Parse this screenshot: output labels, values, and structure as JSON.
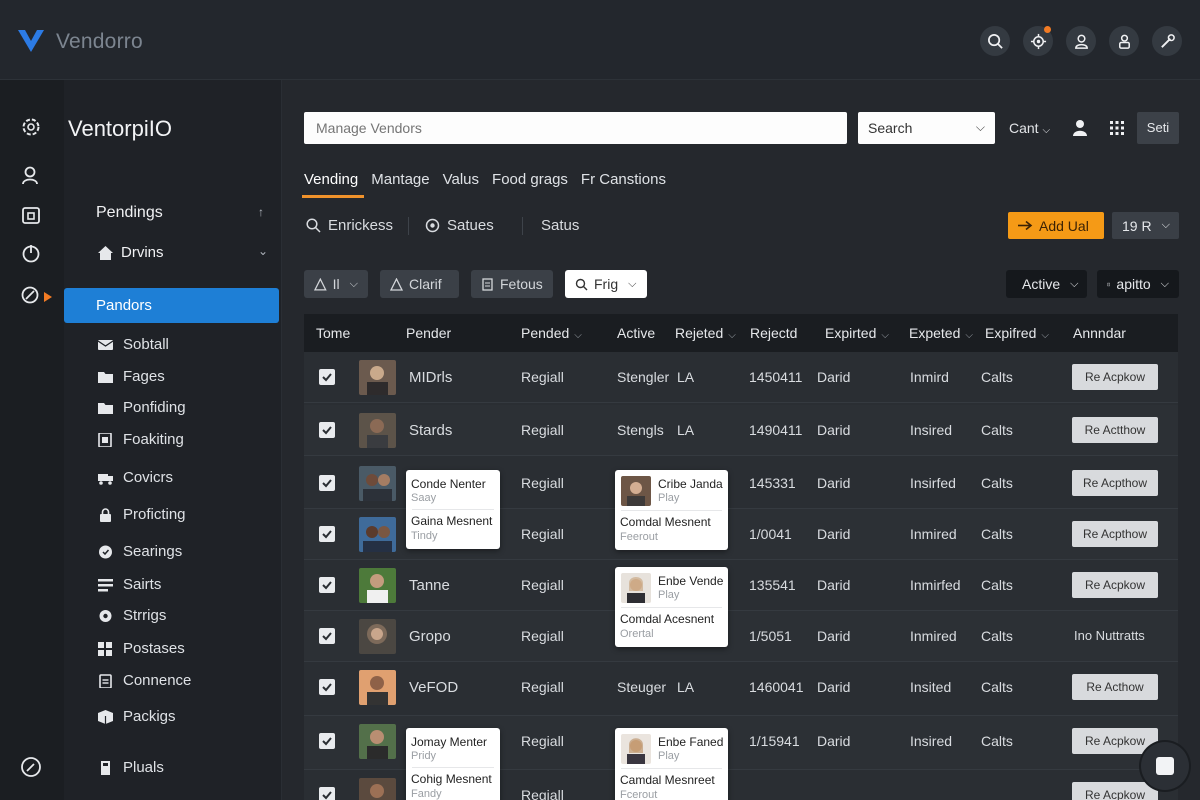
{
  "app": {
    "brand": "Vendorro"
  },
  "top_icons": [
    "search-icon",
    "notifications-icon",
    "user-icon",
    "account-icon",
    "tools-icon"
  ],
  "sidebar": {
    "title": "VentorpiIO",
    "section1": "Pendings",
    "section2": "Drvins",
    "active_item": "Pandors",
    "items": [
      {
        "label": "Sobtall",
        "icon": "mail-icon"
      },
      {
        "label": "Fages",
        "icon": "folder-icon"
      },
      {
        "label": "Ponfiding",
        "icon": "folder-icon"
      },
      {
        "label": "Foakiting",
        "icon": "document-icon"
      },
      {
        "label": "Covicrs",
        "icon": "truck-icon"
      },
      {
        "label": "Proficting",
        "icon": "lock-icon"
      },
      {
        "label": "Searings",
        "icon": "shield-icon"
      },
      {
        "label": "Sairts",
        "icon": "list-icon"
      },
      {
        "label": "Strrigs",
        "icon": "gear-icon"
      },
      {
        "label": "Postases",
        "icon": "grid-icon"
      },
      {
        "label": "Connence",
        "icon": "clipboard-icon"
      },
      {
        "label": "Packigs",
        "icon": "package-icon"
      },
      {
        "label": "Pluals",
        "icon": "bookmark-icon"
      }
    ]
  },
  "header": {
    "search_placeholder": "Manage Vendors",
    "search_select": "Search",
    "cant_label": "Cant",
    "seti_label": "Seti"
  },
  "tabs": [
    "Vending",
    "Mantage",
    "Valus",
    "Food grags",
    "Fr Canstions"
  ],
  "filters": {
    "item1": "Enrickess",
    "item2": "Satues",
    "item3": "Satus",
    "add_button": "Add Ual",
    "page_select": "19 R"
  },
  "toolbar": {
    "btn1": "Il",
    "btn2": "Clarif",
    "btn3": "Fetous",
    "btn4": "Frig",
    "btn5": "Active",
    "btn6": "apitto"
  },
  "table": {
    "headers": [
      "Tome",
      "Pender",
      "Pended",
      "Active",
      "Rejeted",
      "Rejectd",
      "Expirted",
      "Expeted",
      "Expifred",
      "Annndar"
    ],
    "rows": [
      {
        "name": "MIDrls",
        "pended": "Regiall",
        "active": "Stengler",
        "rej1": "LA",
        "rej2": "1450411",
        "exp1": "Darid",
        "exp2": "Inmird",
        "exp3": "Calts",
        "action": "Re Acpkow",
        "action_type": "button"
      },
      {
        "name": "Stards",
        "pended": "Regiall",
        "active": "Stengls",
        "rej1": "LA",
        "rej2": "1490411",
        "exp1": "Darid",
        "exp2": "Insired",
        "exp3": "Calts",
        "action": "Re Actthow",
        "action_type": "button"
      },
      {
        "name": "",
        "pended": "Regiall",
        "active": "",
        "rej1": "",
        "rej2": "145331",
        "exp1": "Darid",
        "exp2": "Insirfed",
        "exp3": "Calts",
        "action": "Re Acpthow",
        "action_type": "button"
      },
      {
        "name": "",
        "pended": "Regiall",
        "active": "",
        "rej1": "",
        "rej2": "1/0041",
        "exp1": "Darid",
        "exp2": "Inmired",
        "exp3": "Calts",
        "action": "Re Acpthow",
        "action_type": "button"
      },
      {
        "name": "Tanne",
        "pended": "Regiall",
        "active": "",
        "rej1": "",
        "rej2": "135541",
        "exp1": "Darid",
        "exp2": "Inmirfed",
        "exp3": "Calts",
        "action": "Re Acpkow",
        "action_type": "button"
      },
      {
        "name": "Gropo",
        "pended": "Regiall",
        "active": "",
        "rej1": "",
        "rej2": "1/5051",
        "exp1": "Darid",
        "exp2": "Inmired",
        "exp3": "Calts",
        "action": "Ino Nuttratts",
        "action_type": "text"
      },
      {
        "name": "VeFOD",
        "pended": "Regiall",
        "active": "Steuger",
        "rej1": "LA",
        "rej2": "1460041",
        "exp1": "Darid",
        "exp2": "Insited",
        "exp3": "Calts",
        "action": "Re Acthow",
        "action_type": "button"
      },
      {
        "name": "",
        "pended": "Regiall",
        "active": "",
        "rej1": "",
        "rej2": "1/15941",
        "exp1": "Darid",
        "exp2": "Insired",
        "exp3": "Calts",
        "action": "Re Acpkow",
        "action_type": "button"
      },
      {
        "name": "",
        "pended": "Regiall",
        "active": "",
        "rej1": "",
        "rej2": "",
        "exp1": "",
        "exp2": "",
        "exp3": "",
        "action": "Re Acpkow",
        "action_type": "button"
      }
    ]
  },
  "cards": {
    "a": {
      "l1": "Conde Nenter",
      "l2": "Saay",
      "l3": "Gaina Mesnent",
      "l4": "Tindy"
    },
    "b": {
      "l1": "Cribe Janda",
      "l2": "Play",
      "l3": "Comdal Mesnent",
      "l4": "Feerout"
    },
    "c": {
      "l1": "Enbe Vende",
      "l2": "Play",
      "l3": "Comdal Acesnent",
      "l4": "Orertal"
    },
    "d": {
      "l1": "Jomay Menter",
      "l2": "Pridy",
      "l3": "Cohig Mesnent",
      "l4": "Fandy"
    },
    "e": {
      "l1": "Enbe Faned",
      "l2": "Play",
      "l3": "Camdal Mesnreet",
      "l4": "Fcerout"
    }
  },
  "colors": {
    "accent_blue": "#1e7fd6",
    "accent_orange": "#f59a16",
    "background": "#25282d"
  }
}
